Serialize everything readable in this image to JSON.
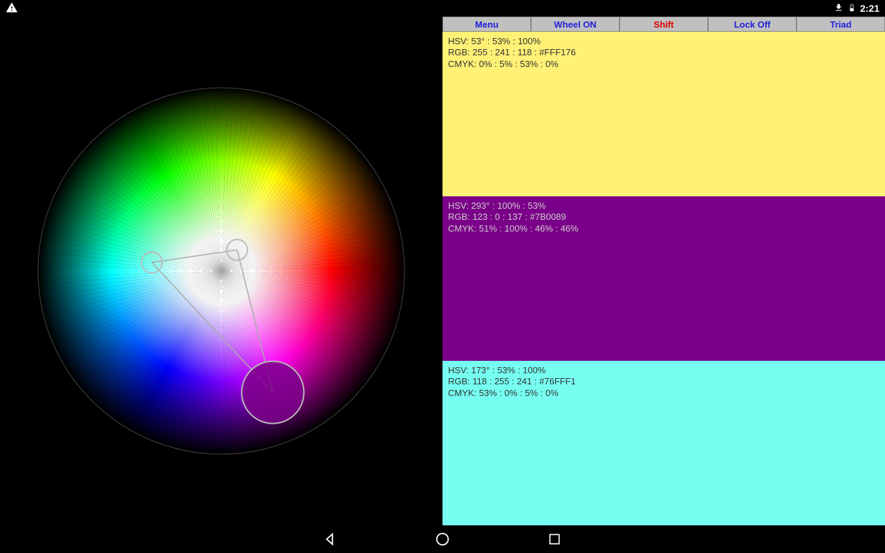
{
  "status": {
    "time": "2:21"
  },
  "toolbar": {
    "menu": "Menu",
    "wheel": "Wheel ON",
    "shift": "Shift",
    "lock": "Lock Off",
    "triad": "Triad"
  },
  "swatches": [
    {
      "bg": "#FFF176",
      "hsv": "HSV: 53° : 53% : 100%",
      "rgb": "RGB: 255 : 241 : 118 : #FFF176",
      "cmyk": "CMYK: 0% : 5% : 53% : 0%",
      "textClass": ""
    },
    {
      "bg": "#7B0089",
      "hsv": "HSV: 293° : 100% : 53%",
      "rgb": "RGB: 123 : 0 : 137 : #7B0089",
      "cmyk": "CMYK: 51% : 100% : 46% : 46%",
      "textClass": "swatch-purple"
    },
    {
      "bg": "#76FFF1",
      "hsv": "HSV: 173° : 53% : 100%",
      "rgb": "RGB: 118 : 255 : 241 : #76FFF1",
      "cmyk": "CMYK: 53% : 0% : 5% : 0%",
      "textClass": ""
    }
  ],
  "wheel": {
    "radius": 265,
    "points": [
      {
        "name": "purple-node",
        "angle": 293,
        "sat": 1.0,
        "r": 45,
        "fill": "#7B0089"
      },
      {
        "name": "cyan-node",
        "angle": 173,
        "sat": 0.53,
        "r": 15,
        "fill": "none"
      },
      {
        "name": "yellow-node",
        "angle": 53,
        "sat": 0.2,
        "r": 15,
        "fill": "none"
      }
    ]
  }
}
